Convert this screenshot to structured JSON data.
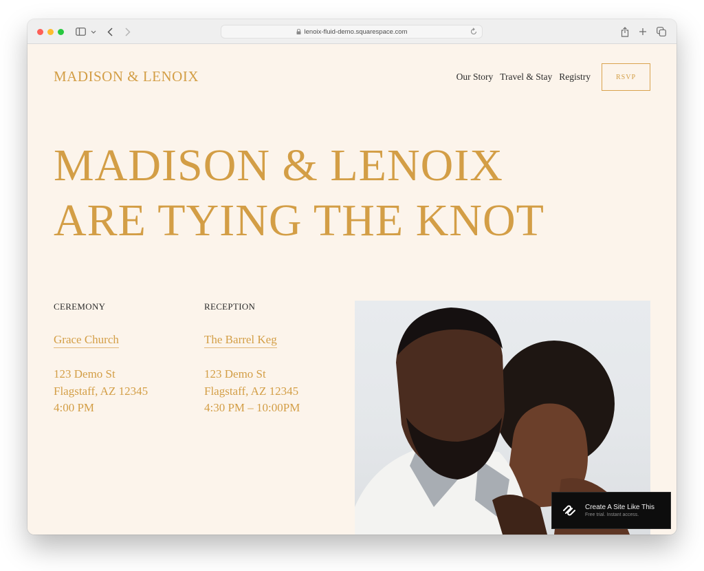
{
  "browser": {
    "url": "lenoix-fluid-demo.squarespace.com",
    "icons": {
      "sidebar": "sidebar-toggle-icon",
      "chevron": "chevron-down-icon",
      "back": "back-arrow-icon",
      "forward": "forward-arrow-icon",
      "lock": "lock-icon",
      "reload": "reload-icon",
      "share": "share-icon",
      "new_tab": "plus-icon",
      "tabs": "tab-overview-icon"
    }
  },
  "header": {
    "logo": "MADISON & LENOIX",
    "nav": [
      {
        "label": "Our Story"
      },
      {
        "label": "Travel & Stay"
      },
      {
        "label": "Registry"
      }
    ],
    "rsvp_label": "RSVP"
  },
  "hero": {
    "line1": "MADISON & LENOIX",
    "line2": "ARE TYING THE KNOT"
  },
  "events": [
    {
      "label": "CEREMONY",
      "venue": "Grace Church",
      "address": "123 Demo St",
      "city": "Flagstaff, AZ 12345",
      "time": "4:00 PM"
    },
    {
      "label": "RECEPTION",
      "venue": "The Barrel Keg",
      "address": "123 Demo St",
      "city": "Flagstaff, AZ 12345",
      "time": "4:30 PM – 10:00PM"
    }
  ],
  "photo": {
    "description": "Couple portrait: bearded man in white shirt with woman resting her head on his shoulder"
  },
  "promo": {
    "title": "Create A Site Like This",
    "subtitle": "Free trial. Instant access.",
    "icon": "squarespace-logo-icon"
  },
  "colors": {
    "accent": "#d39e46",
    "background": "#fcf4eb",
    "text": "#2b2b2b"
  }
}
